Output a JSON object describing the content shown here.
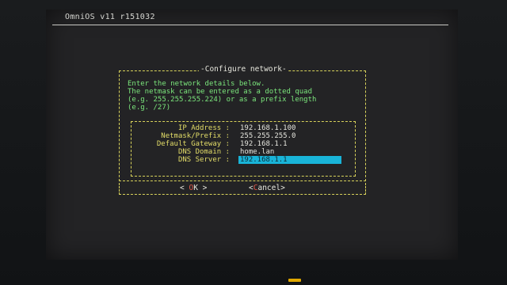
{
  "console": {
    "title": "OmniOS v11 r151032"
  },
  "dialog": {
    "title": "Configure network",
    "message": [
      "Enter the network details below.",
      "The netmask can be entered as a dotted quad",
      "(e.g. 255.255.255.224) or as a prefix length",
      "(e.g. /27)"
    ],
    "fields": [
      {
        "label": "IP Address :",
        "value": "192.168.1.100"
      },
      {
        "label": "Netmask/Prefix :",
        "value": "255.255.255.0"
      },
      {
        "label": "Default Gateway :",
        "value": "192.168.1.1"
      },
      {
        "label": "DNS Domain :",
        "value": "home.lan"
      },
      {
        "label": "DNS Server :",
        "value": "192.168.1.1"
      }
    ],
    "buttons": {
      "ok": {
        "prefix": "< ",
        "hotkey": "O",
        "rest": "K",
        "suffix": " >"
      },
      "cancel": {
        "prefix": "<",
        "hotkey": "C",
        "rest": "ancel",
        "suffix": ">"
      }
    }
  },
  "colors": {
    "border": "#d9d35b",
    "message": "#7be67c",
    "label": "#e3dd68",
    "value": "#e6e6df",
    "input_highlight": "#19b4d8",
    "hotkey": "#e35b4c",
    "power_led": "#e0a800"
  }
}
